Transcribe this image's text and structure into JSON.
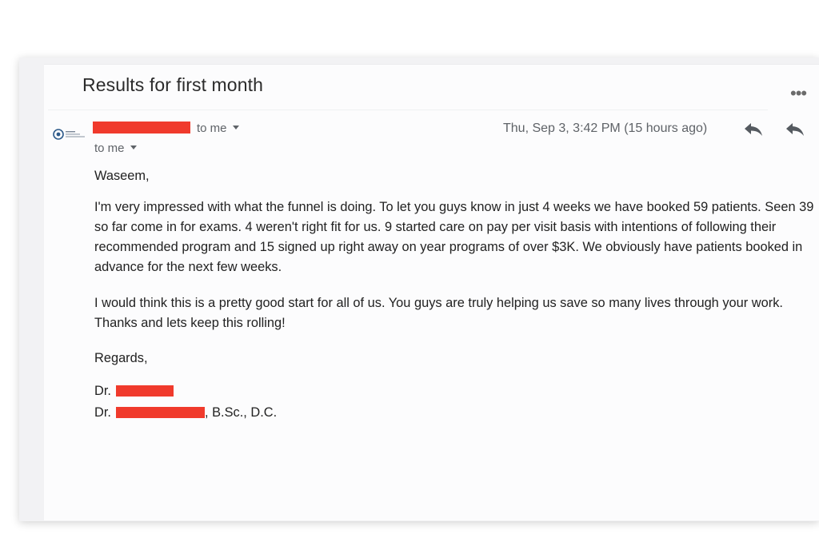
{
  "email": {
    "subject": "Results for first month",
    "sender": {
      "to_label": "to me"
    },
    "recipient_line": "to me",
    "date": "Thu, Sep 3, 3:42 PM (15 hours ago)",
    "icons": {
      "more": "more-horizontal-icon",
      "reply": "reply-icon",
      "reply_all": "reply-all-icon",
      "avatar": "sender-logo-icon"
    },
    "body": {
      "greeting": "Waseem,",
      "paragraph1": "I'm very impressed with what the funnel is doing. To let you guys know in just 4 weeks we have booked 59 patients. Seen 39 so far come in for exams. 4 weren't right fit for us. 9 started care on pay per visit basis with intentions of following their recommended program and 15 signed up right away on year programs of over $3K. We obviously have patients booked in advance for the next few weeks.",
      "paragraph2": "I would think this is a pretty good start for all of us. You guys are truly helping us save so many lives through your work. Thanks and lets keep this rolling!",
      "closing": "Regards,"
    },
    "signature": {
      "line1_prefix": "Dr.",
      "line2_prefix": "Dr.",
      "line2_suffix": ", B.Sc., D.C."
    },
    "colors": {
      "redaction": "#f03a2c",
      "text": "#222222",
      "muted": "#5f6368"
    }
  }
}
